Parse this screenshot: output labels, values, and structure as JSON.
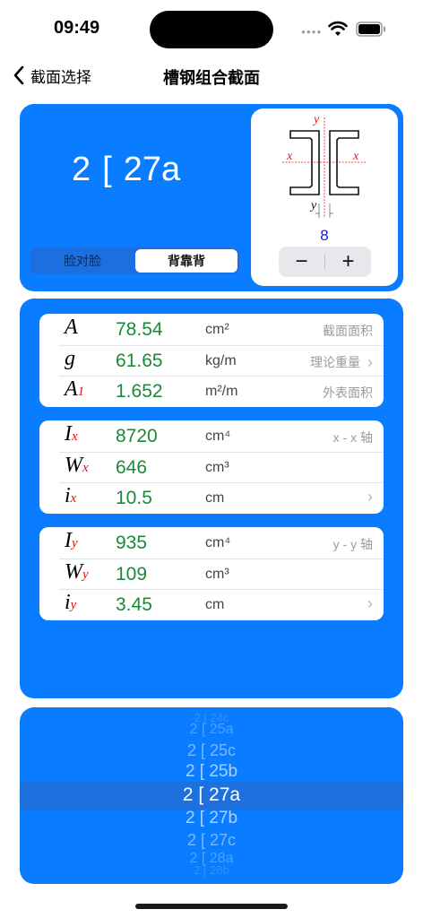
{
  "status_bar": {
    "time": "09:49"
  },
  "nav": {
    "back_label": "截面选择",
    "title": "槽钢组合截面"
  },
  "section": {
    "designation": {
      "count": "2",
      "symbol": "[",
      "size": "27a"
    },
    "orientation": {
      "options": [
        "脸对脸",
        "背靠背"
      ],
      "selected": "背靠背"
    },
    "diagram": {
      "axis_y": "y",
      "axis_x": "x",
      "spacing": "8"
    },
    "stepper": {
      "minus": "−",
      "plus": "+"
    }
  },
  "properties": {
    "group1": [
      {
        "symbol": "A",
        "sub": "",
        "value": "78.54",
        "unit": "cm²",
        "note": "截面面积",
        "chevron": false
      },
      {
        "symbol": "g",
        "sub": "",
        "value": "61.65",
        "unit": "kg/m",
        "note": "理论重量",
        "chevron": true
      },
      {
        "symbol": "A",
        "sub": "1",
        "value": "1.652",
        "unit": "m²/m",
        "note": "外表面积",
        "chevron": false
      }
    ],
    "group2": [
      {
        "symbol": "I",
        "sub": "x",
        "value": "8720",
        "unit": "cm⁴",
        "note": "x - x 轴",
        "chevron": false
      },
      {
        "symbol": "W",
        "sub": "x",
        "value": "646",
        "unit": "cm³",
        "note": "",
        "chevron": false
      },
      {
        "symbol": "i",
        "sub": "x",
        "value": "10.5",
        "unit": "cm",
        "note": "",
        "chevron": true
      }
    ],
    "group3": [
      {
        "symbol": "I",
        "sub": "y",
        "value": "935",
        "unit": "cm⁴",
        "note": "y - y 轴",
        "chevron": false
      },
      {
        "symbol": "W",
        "sub": "y",
        "value": "109",
        "unit": "cm³",
        "note": "",
        "chevron": false
      },
      {
        "symbol": "i",
        "sub": "y",
        "value": "3.45",
        "unit": "cm",
        "note": "",
        "chevron": true
      }
    ]
  },
  "picker": {
    "items": [
      "2 [ 24c",
      "2 [ 25a",
      "2 [ 25b",
      "2 [ 25c",
      "2 [ 27a",
      "2 [ 27b",
      "2 [ 27c",
      "2 [ 28a",
      "2 [ 28b"
    ],
    "selected": "2 [ 27a"
  },
  "colors": {
    "accent": "#0a7cff",
    "value_green": "#1a8a3a",
    "subscript_red": "#e01010",
    "spacing_blue": "#1020e0"
  },
  "chevron_glyph": "›"
}
